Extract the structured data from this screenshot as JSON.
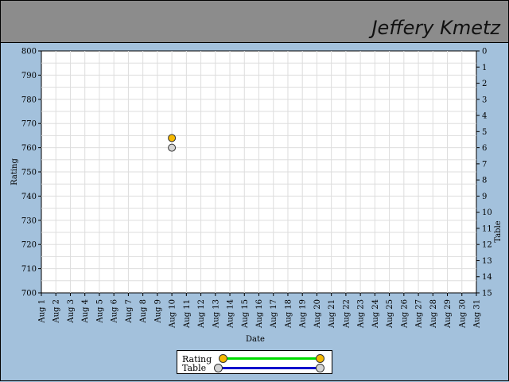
{
  "header": {
    "player_name": "Jeffery Kmetz"
  },
  "colors": {
    "rating_line": "#00dd00",
    "table_line": "#0000cc",
    "rating_marker": "#f5b800",
    "table_marker": "#d4d4d4",
    "grid": "#dddddd"
  },
  "chart_data": {
    "type": "scatter",
    "x_label": "Date",
    "y_left_label": "Rating",
    "y_right_label": "Table",
    "categories": [
      "Aug 1",
      "Aug 2",
      "Aug 3",
      "Aug 4",
      "Aug 5",
      "Aug 6",
      "Aug 7",
      "Aug 8",
      "Aug 9",
      "Aug 10",
      "Aug 11",
      "Aug 12",
      "Aug 13",
      "Aug 14",
      "Aug 15",
      "Aug 16",
      "Aug 17",
      "Aug 18",
      "Aug 19",
      "Aug 20",
      "Aug 21",
      "Aug 22",
      "Aug 23",
      "Aug 24",
      "Aug 25",
      "Aug 26",
      "Aug 27",
      "Aug 28",
      "Aug 29",
      "Aug 30",
      "Aug 31"
    ],
    "y_left_range": [
      700,
      800
    ],
    "y_left_ticks": [
      800,
      790,
      780,
      770,
      760,
      750,
      740,
      730,
      720,
      710,
      700
    ],
    "y_right_range": [
      0,
      15
    ],
    "y_right_ticks": [
      0,
      1,
      2,
      3,
      4,
      5,
      6,
      7,
      8,
      9,
      10,
      11,
      12,
      13,
      14,
      15
    ],
    "grid": true,
    "legend_position": "bottom-center",
    "series": [
      {
        "name": "Rating",
        "axis": "left",
        "points": [
          {
            "x": "Aug 10",
            "y": 764
          }
        ]
      },
      {
        "name": "Table",
        "axis": "right",
        "points": [
          {
            "x": "Aug 10",
            "y": 6
          }
        ]
      }
    ]
  }
}
